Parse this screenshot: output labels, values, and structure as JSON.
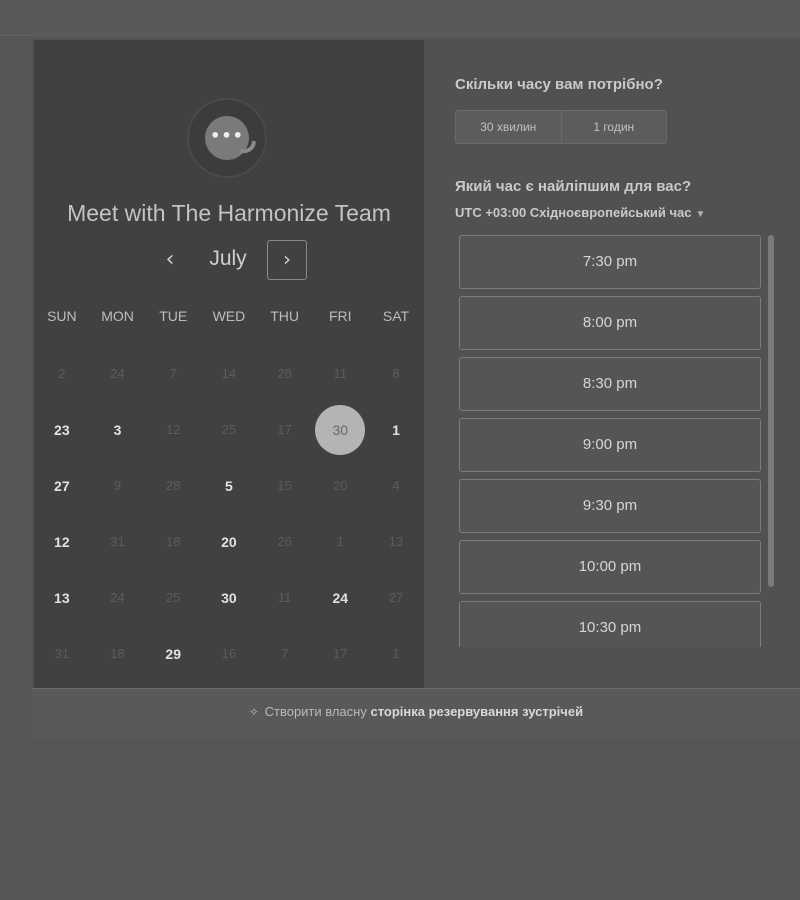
{
  "calendar": {
    "title": "Meet with The Harmonize Team",
    "logo_icon": "chat-bubble-logo",
    "month": "July",
    "prev_icon": "‹",
    "next_icon": "›",
    "weekdays": [
      "SUN",
      "MON",
      "TUE",
      "WED",
      "THU",
      "FRI",
      "SAT"
    ],
    "weeks": [
      [
        {
          "d": "2",
          "a": false
        },
        {
          "d": "24",
          "a": false
        },
        {
          "d": "7",
          "a": false
        },
        {
          "d": "14",
          "a": false
        },
        {
          "d": "28",
          "a": false
        },
        {
          "d": "11",
          "a": false
        },
        {
          "d": "8",
          "a": false
        }
      ],
      [
        {
          "d": "23",
          "a": true
        },
        {
          "d": "3",
          "a": true
        },
        {
          "d": "12",
          "a": false
        },
        {
          "d": "25",
          "a": false
        },
        {
          "d": "17",
          "a": false
        },
        {
          "d": "30",
          "a": true,
          "sel": true
        },
        {
          "d": "1",
          "a": true
        }
      ],
      [
        {
          "d": "27",
          "a": true
        },
        {
          "d": "9",
          "a": false
        },
        {
          "d": "28",
          "a": false
        },
        {
          "d": "5",
          "a": true
        },
        {
          "d": "15",
          "a": false
        },
        {
          "d": "20",
          "a": false
        },
        {
          "d": "4",
          "a": false
        }
      ],
      [
        {
          "d": "12",
          "a": true
        },
        {
          "d": "31",
          "a": false
        },
        {
          "d": "18",
          "a": false
        },
        {
          "d": "20",
          "a": true
        },
        {
          "d": "26",
          "a": false
        },
        {
          "d": "1",
          "a": false
        },
        {
          "d": "13",
          "a": false
        }
      ],
      [
        {
          "d": "13",
          "a": true
        },
        {
          "d": "24",
          "a": false
        },
        {
          "d": "25",
          "a": false
        },
        {
          "d": "30",
          "a": true
        },
        {
          "d": "11",
          "a": false
        },
        {
          "d": "24",
          "a": true
        },
        {
          "d": "27",
          "a": false
        }
      ],
      [
        {
          "d": "31",
          "a": false
        },
        {
          "d": "18",
          "a": false
        },
        {
          "d": "29",
          "a": true
        },
        {
          "d": "16",
          "a": false
        },
        {
          "d": "7",
          "a": false
        },
        {
          "d": "17",
          "a": false
        },
        {
          "d": "1",
          "a": false
        }
      ]
    ]
  },
  "booking": {
    "duration_question": "Скільки часу вам потрібно?",
    "durations": [
      "30 хвилин",
      "1 годин"
    ],
    "time_question": "Який час є найліпшим для вас?",
    "timezone": "UTC +03:00 Східноєвропейський час",
    "slots": [
      "7:30 pm",
      "8:00 pm",
      "8:30 pm",
      "9:00 pm",
      "9:30 pm",
      "10:00 pm",
      "10:30 pm"
    ]
  },
  "footer": {
    "prefix": "Створити власну",
    "link": "сторінка резервування зустрічей",
    "icon": "sparkle-icon"
  }
}
